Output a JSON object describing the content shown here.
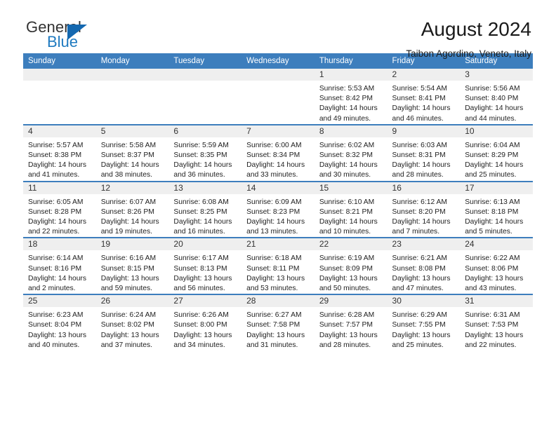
{
  "brand": {
    "name_top": "General",
    "name_bottom": "Blue",
    "triangle_color": "#1468b0",
    "blue_color": "#1f7ac0"
  },
  "header": {
    "month_title": "August 2024",
    "location": "Taibon Agordino, Veneto, Italy"
  },
  "theme": {
    "header_blue": "#3d7ebd",
    "daynum_gray": "#efefef"
  },
  "weekday_headers": [
    "Sunday",
    "Monday",
    "Tuesday",
    "Wednesday",
    "Thursday",
    "Friday",
    "Saturday"
  ],
  "weeks": [
    [
      {
        "empty": true
      },
      {
        "empty": true
      },
      {
        "empty": true
      },
      {
        "empty": true
      },
      {
        "day": "1",
        "sunrise": "Sunrise: 5:53 AM",
        "sunset": "Sunset: 8:42 PM",
        "daylight1": "Daylight: 14 hours",
        "daylight2": "and 49 minutes."
      },
      {
        "day": "2",
        "sunrise": "Sunrise: 5:54 AM",
        "sunset": "Sunset: 8:41 PM",
        "daylight1": "Daylight: 14 hours",
        "daylight2": "and 46 minutes."
      },
      {
        "day": "3",
        "sunrise": "Sunrise: 5:56 AM",
        "sunset": "Sunset: 8:40 PM",
        "daylight1": "Daylight: 14 hours",
        "daylight2": "and 44 minutes."
      }
    ],
    [
      {
        "day": "4",
        "sunrise": "Sunrise: 5:57 AM",
        "sunset": "Sunset: 8:38 PM",
        "daylight1": "Daylight: 14 hours",
        "daylight2": "and 41 minutes."
      },
      {
        "day": "5",
        "sunrise": "Sunrise: 5:58 AM",
        "sunset": "Sunset: 8:37 PM",
        "daylight1": "Daylight: 14 hours",
        "daylight2": "and 38 minutes."
      },
      {
        "day": "6",
        "sunrise": "Sunrise: 5:59 AM",
        "sunset": "Sunset: 8:35 PM",
        "daylight1": "Daylight: 14 hours",
        "daylight2": "and 36 minutes."
      },
      {
        "day": "7",
        "sunrise": "Sunrise: 6:00 AM",
        "sunset": "Sunset: 8:34 PM",
        "daylight1": "Daylight: 14 hours",
        "daylight2": "and 33 minutes."
      },
      {
        "day": "8",
        "sunrise": "Sunrise: 6:02 AM",
        "sunset": "Sunset: 8:32 PM",
        "daylight1": "Daylight: 14 hours",
        "daylight2": "and 30 minutes."
      },
      {
        "day": "9",
        "sunrise": "Sunrise: 6:03 AM",
        "sunset": "Sunset: 8:31 PM",
        "daylight1": "Daylight: 14 hours",
        "daylight2": "and 28 minutes."
      },
      {
        "day": "10",
        "sunrise": "Sunrise: 6:04 AM",
        "sunset": "Sunset: 8:29 PM",
        "daylight1": "Daylight: 14 hours",
        "daylight2": "and 25 minutes."
      }
    ],
    [
      {
        "day": "11",
        "sunrise": "Sunrise: 6:05 AM",
        "sunset": "Sunset: 8:28 PM",
        "daylight1": "Daylight: 14 hours",
        "daylight2": "and 22 minutes."
      },
      {
        "day": "12",
        "sunrise": "Sunrise: 6:07 AM",
        "sunset": "Sunset: 8:26 PM",
        "daylight1": "Daylight: 14 hours",
        "daylight2": "and 19 minutes."
      },
      {
        "day": "13",
        "sunrise": "Sunrise: 6:08 AM",
        "sunset": "Sunset: 8:25 PM",
        "daylight1": "Daylight: 14 hours",
        "daylight2": "and 16 minutes."
      },
      {
        "day": "14",
        "sunrise": "Sunrise: 6:09 AM",
        "sunset": "Sunset: 8:23 PM",
        "daylight1": "Daylight: 14 hours",
        "daylight2": "and 13 minutes."
      },
      {
        "day": "15",
        "sunrise": "Sunrise: 6:10 AM",
        "sunset": "Sunset: 8:21 PM",
        "daylight1": "Daylight: 14 hours",
        "daylight2": "and 10 minutes."
      },
      {
        "day": "16",
        "sunrise": "Sunrise: 6:12 AM",
        "sunset": "Sunset: 8:20 PM",
        "daylight1": "Daylight: 14 hours",
        "daylight2": "and 7 minutes."
      },
      {
        "day": "17",
        "sunrise": "Sunrise: 6:13 AM",
        "sunset": "Sunset: 8:18 PM",
        "daylight1": "Daylight: 14 hours",
        "daylight2": "and 5 minutes."
      }
    ],
    [
      {
        "day": "18",
        "sunrise": "Sunrise: 6:14 AM",
        "sunset": "Sunset: 8:16 PM",
        "daylight1": "Daylight: 14 hours",
        "daylight2": "and 2 minutes."
      },
      {
        "day": "19",
        "sunrise": "Sunrise: 6:16 AM",
        "sunset": "Sunset: 8:15 PM",
        "daylight1": "Daylight: 13 hours",
        "daylight2": "and 59 minutes."
      },
      {
        "day": "20",
        "sunrise": "Sunrise: 6:17 AM",
        "sunset": "Sunset: 8:13 PM",
        "daylight1": "Daylight: 13 hours",
        "daylight2": "and 56 minutes."
      },
      {
        "day": "21",
        "sunrise": "Sunrise: 6:18 AM",
        "sunset": "Sunset: 8:11 PM",
        "daylight1": "Daylight: 13 hours",
        "daylight2": "and 53 minutes."
      },
      {
        "day": "22",
        "sunrise": "Sunrise: 6:19 AM",
        "sunset": "Sunset: 8:09 PM",
        "daylight1": "Daylight: 13 hours",
        "daylight2": "and 50 minutes."
      },
      {
        "day": "23",
        "sunrise": "Sunrise: 6:21 AM",
        "sunset": "Sunset: 8:08 PM",
        "daylight1": "Daylight: 13 hours",
        "daylight2": "and 47 minutes."
      },
      {
        "day": "24",
        "sunrise": "Sunrise: 6:22 AM",
        "sunset": "Sunset: 8:06 PM",
        "daylight1": "Daylight: 13 hours",
        "daylight2": "and 43 minutes."
      }
    ],
    [
      {
        "day": "25",
        "sunrise": "Sunrise: 6:23 AM",
        "sunset": "Sunset: 8:04 PM",
        "daylight1": "Daylight: 13 hours",
        "daylight2": "and 40 minutes."
      },
      {
        "day": "26",
        "sunrise": "Sunrise: 6:24 AM",
        "sunset": "Sunset: 8:02 PM",
        "daylight1": "Daylight: 13 hours",
        "daylight2": "and 37 minutes."
      },
      {
        "day": "27",
        "sunrise": "Sunrise: 6:26 AM",
        "sunset": "Sunset: 8:00 PM",
        "daylight1": "Daylight: 13 hours",
        "daylight2": "and 34 minutes."
      },
      {
        "day": "28",
        "sunrise": "Sunrise: 6:27 AM",
        "sunset": "Sunset: 7:58 PM",
        "daylight1": "Daylight: 13 hours",
        "daylight2": "and 31 minutes."
      },
      {
        "day": "29",
        "sunrise": "Sunrise: 6:28 AM",
        "sunset": "Sunset: 7:57 PM",
        "daylight1": "Daylight: 13 hours",
        "daylight2": "and 28 minutes."
      },
      {
        "day": "30",
        "sunrise": "Sunrise: 6:29 AM",
        "sunset": "Sunset: 7:55 PM",
        "daylight1": "Daylight: 13 hours",
        "daylight2": "and 25 minutes."
      },
      {
        "day": "31",
        "sunrise": "Sunrise: 6:31 AM",
        "sunset": "Sunset: 7:53 PM",
        "daylight1": "Daylight: 13 hours",
        "daylight2": "and 22 minutes."
      }
    ]
  ]
}
